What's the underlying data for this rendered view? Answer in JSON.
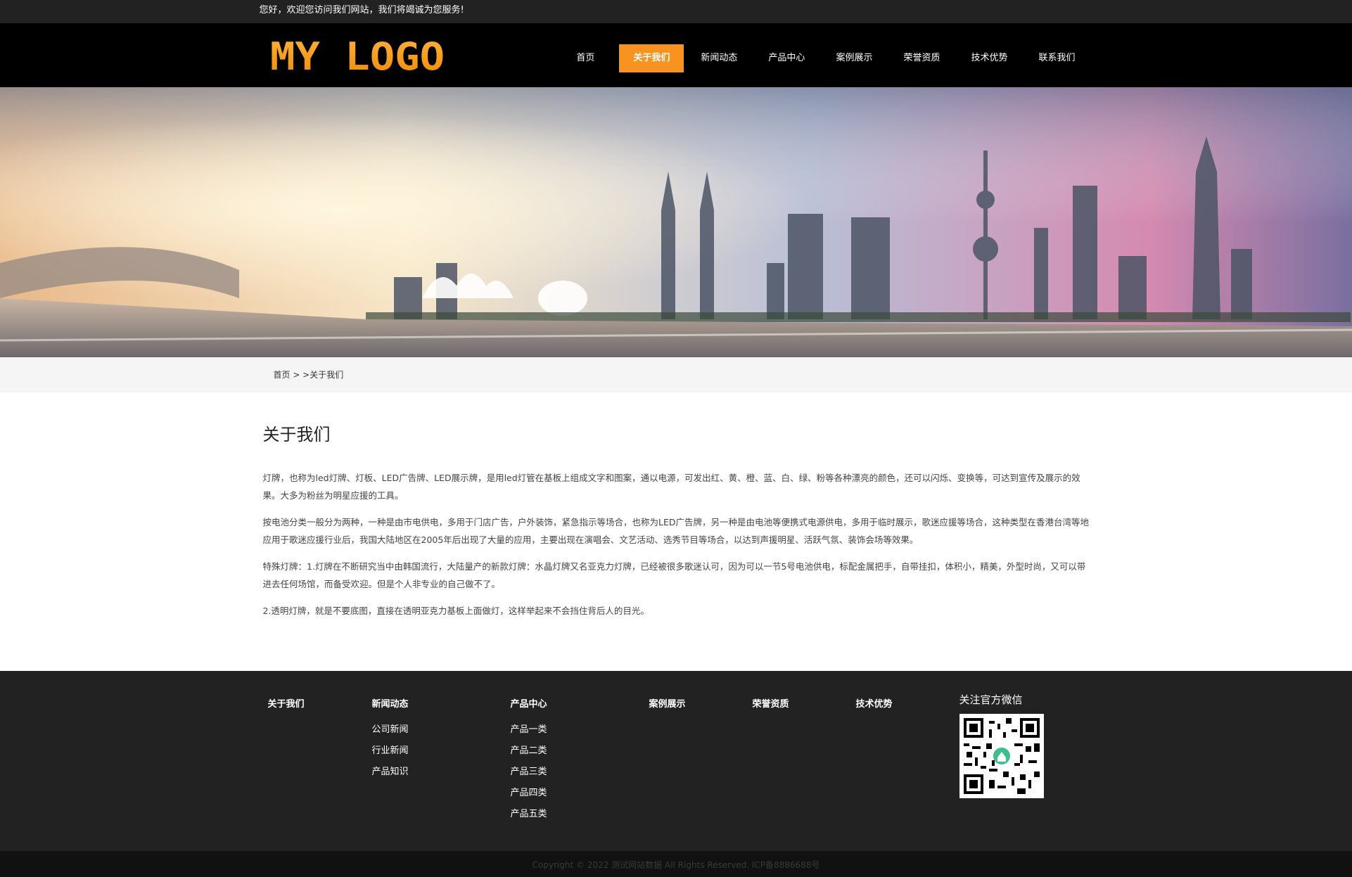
{
  "topbar": {
    "welcome": "您好，欢迎您访问我们网站，我们将竭诚为您服务!"
  },
  "header": {
    "logo_text": "MY LOGO",
    "nav": [
      {
        "label": "首页",
        "active": false
      },
      {
        "label": "关于我们",
        "active": true
      },
      {
        "label": "新闻动态",
        "active": false
      },
      {
        "label": "产品中心",
        "active": false
      },
      {
        "label": "案例展示",
        "active": false
      },
      {
        "label": "荣誉资质",
        "active": false
      },
      {
        "label": "技术优势",
        "active": false
      },
      {
        "label": "联系我们",
        "active": false
      }
    ]
  },
  "breadcrumb": {
    "text": "首页 > >关于我们"
  },
  "main": {
    "title": "关于我们",
    "paragraphs": [
      "灯牌，也称为led灯牌、灯板、LED广告牌、LED展示牌，是用led灯管在基板上组成文字和图案，通以电源，可发出红、黄、橙、蓝、白、绿、粉等各种漂亮的颜色，还可以闪烁、变换等，可达到宣传及展示的效果。大多为粉丝为明星应援的工具。",
      "按电池分类一般分为两种，一种是由市电供电，多用于门店广告，户外装饰，紧急指示等场合，也称为LED广告牌，另一种是由电池等便携式电源供电，多用于临时展示，歌迷应援等场合，这种类型在香港台湾等地应用于歌迷应援行业后，我国大陆地区在2005年后出现了大量的应用，主要出现在演唱会、文艺活动、选秀节目等场合，以达到声援明星、活跃气氛、装饰会场等效果。",
      "特殊灯牌：1.灯牌在不断研究当中由韩国流行，大陆量产的新款灯牌：水晶灯牌又名亚克力灯牌，已经被很多歌迷认可，因为可以一节5号电池供电，标配金属把手，自带挂扣，体积小，精美，外型时尚，又可以带进去任何场馆，而备受欢迎。但是个人非专业的自己做不了。",
      "2.透明灯牌，就是不要底图，直接在透明亚克力基板上面做灯，这样举起来不会挡住背后人的目光。"
    ]
  },
  "footer": {
    "columns": [
      {
        "title": "关于我们",
        "links": []
      },
      {
        "title": "新闻动态",
        "links": [
          "公司新闻",
          "行业新闻",
          "产品知识"
        ]
      },
      {
        "title": "产品中心",
        "links": [
          "产品一类",
          "产品二类",
          "产品三类",
          "产品四类",
          "产品五类"
        ]
      },
      {
        "title": "案例展示",
        "links": []
      },
      {
        "title": "荣誉资质",
        "links": []
      },
      {
        "title": "技术优势",
        "links": []
      }
    ],
    "wechat_title": "关注官方微信"
  },
  "copyright": {
    "text": "Copyright © 2022 测试网站数据 All Rights Reserved.   ICP备8886688号"
  },
  "colors": {
    "accent": "#f7931e",
    "topbar": "#222222",
    "header": "#000000",
    "footer": "#222222"
  }
}
